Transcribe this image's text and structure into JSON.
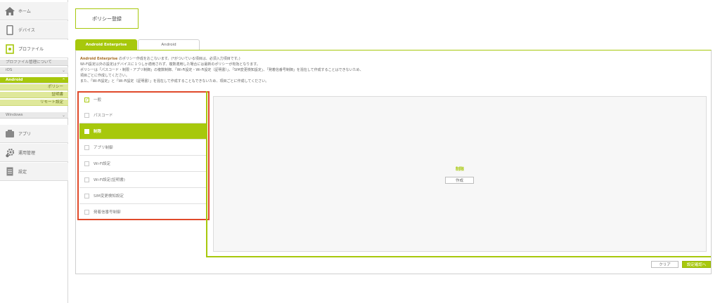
{
  "sidebar": {
    "home": "ホーム",
    "devices": "デバイス",
    "profile": "プロファイル",
    "profile_management": "プロファイル管理について",
    "ios": "iOS",
    "android": "Android",
    "android_children": [
      "ポリシー",
      "証明書",
      "リモート設定"
    ],
    "windows": "Windows",
    "apps": "アプリ",
    "operations": "運用管理",
    "settings": "設定"
  },
  "page": {
    "title": "ポリシー登録"
  },
  "tabs": [
    {
      "label": "Android Enterprise",
      "active": true
    },
    {
      "label": "Android",
      "active": false
    }
  ],
  "description": {
    "line1_highlight": "Android Enterprise",
    "line1_rest": " のポリシー作成をおこないます。(*がついている項目は、必須入力項目です。)",
    "line2": "Wi-Fi設定以外の設定はデバイスに１つしか適用されず、複数適用した場合には最新のポリシーが有効となります。",
    "line3": "ポリシーは「パスコード・制限・アプリ制御」の複数制御、「Wi-Fi設定・Wi-Fi設定（証明書）」、「SIM変更検知設定」、「発着信番号制御」を混在して作成することはできないため、",
    "line4": "項目ごとに作成してください。",
    "line5": "また、「Wi-Fi設定」と「Wi-Fi設定（証明書）」を混在して作成することもできないため、項目ごとに作成してください。"
  },
  "policy_items": [
    {
      "label": "一般",
      "checked": true,
      "selected": false
    },
    {
      "label": "パスコード",
      "checked": false,
      "selected": false
    },
    {
      "label": "制限",
      "checked": false,
      "selected": true
    },
    {
      "label": "アプリ制御",
      "checked": false,
      "selected": false
    },
    {
      "label": "Wi-Fi設定",
      "checked": false,
      "selected": false
    },
    {
      "label": "Wi-Fi設定(証明書)",
      "checked": false,
      "selected": false
    },
    {
      "label": "SIM変更検知設定",
      "checked": false,
      "selected": false
    },
    {
      "label": "発着信番号制御",
      "checked": false,
      "selected": false
    }
  ],
  "panel": {
    "title": "制限",
    "create_label": "作成"
  },
  "footer": {
    "clear_label": "クリア",
    "confirm_label": "設定確認へ"
  },
  "colors": {
    "accent": "#a7c80c",
    "highlight_frame": "#e04a2a"
  }
}
